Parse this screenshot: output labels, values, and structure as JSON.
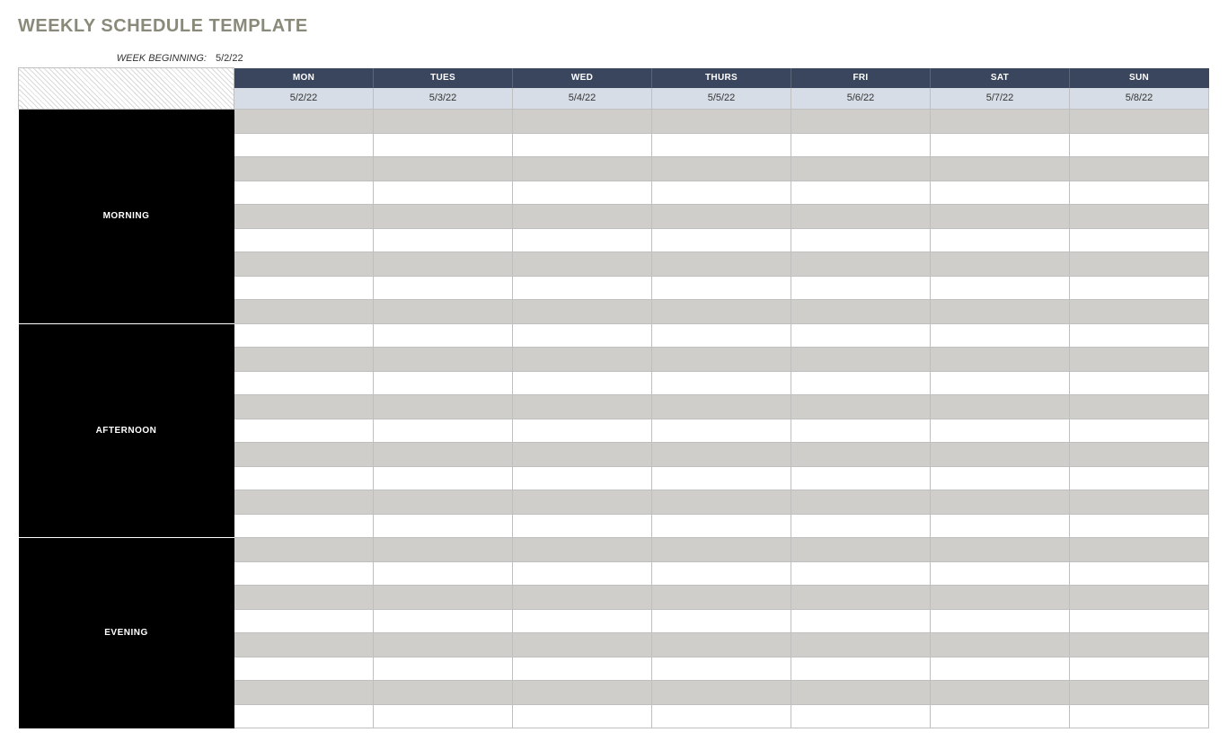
{
  "title": "WEEKLY SCHEDULE TEMPLATE",
  "week_beginning_label": "WEEK BEGINNING:",
  "week_beginning_value": "5/2/22",
  "days": [
    {
      "name": "MON",
      "date": "5/2/22"
    },
    {
      "name": "TUES",
      "date": "5/3/22"
    },
    {
      "name": "WED",
      "date": "5/4/22"
    },
    {
      "name": "THURS",
      "date": "5/5/22"
    },
    {
      "name": "FRI",
      "date": "5/6/22"
    },
    {
      "name": "SAT",
      "date": "5/7/22"
    },
    {
      "name": "SUN",
      "date": "5/8/22"
    }
  ],
  "sections": [
    {
      "label": "MORNING",
      "rows": 9,
      "first_shaded": true
    },
    {
      "label": "AFTERNOON",
      "rows": 9,
      "first_shaded": false
    },
    {
      "label": "EVENING",
      "rows": 8,
      "first_shaded": true
    }
  ]
}
